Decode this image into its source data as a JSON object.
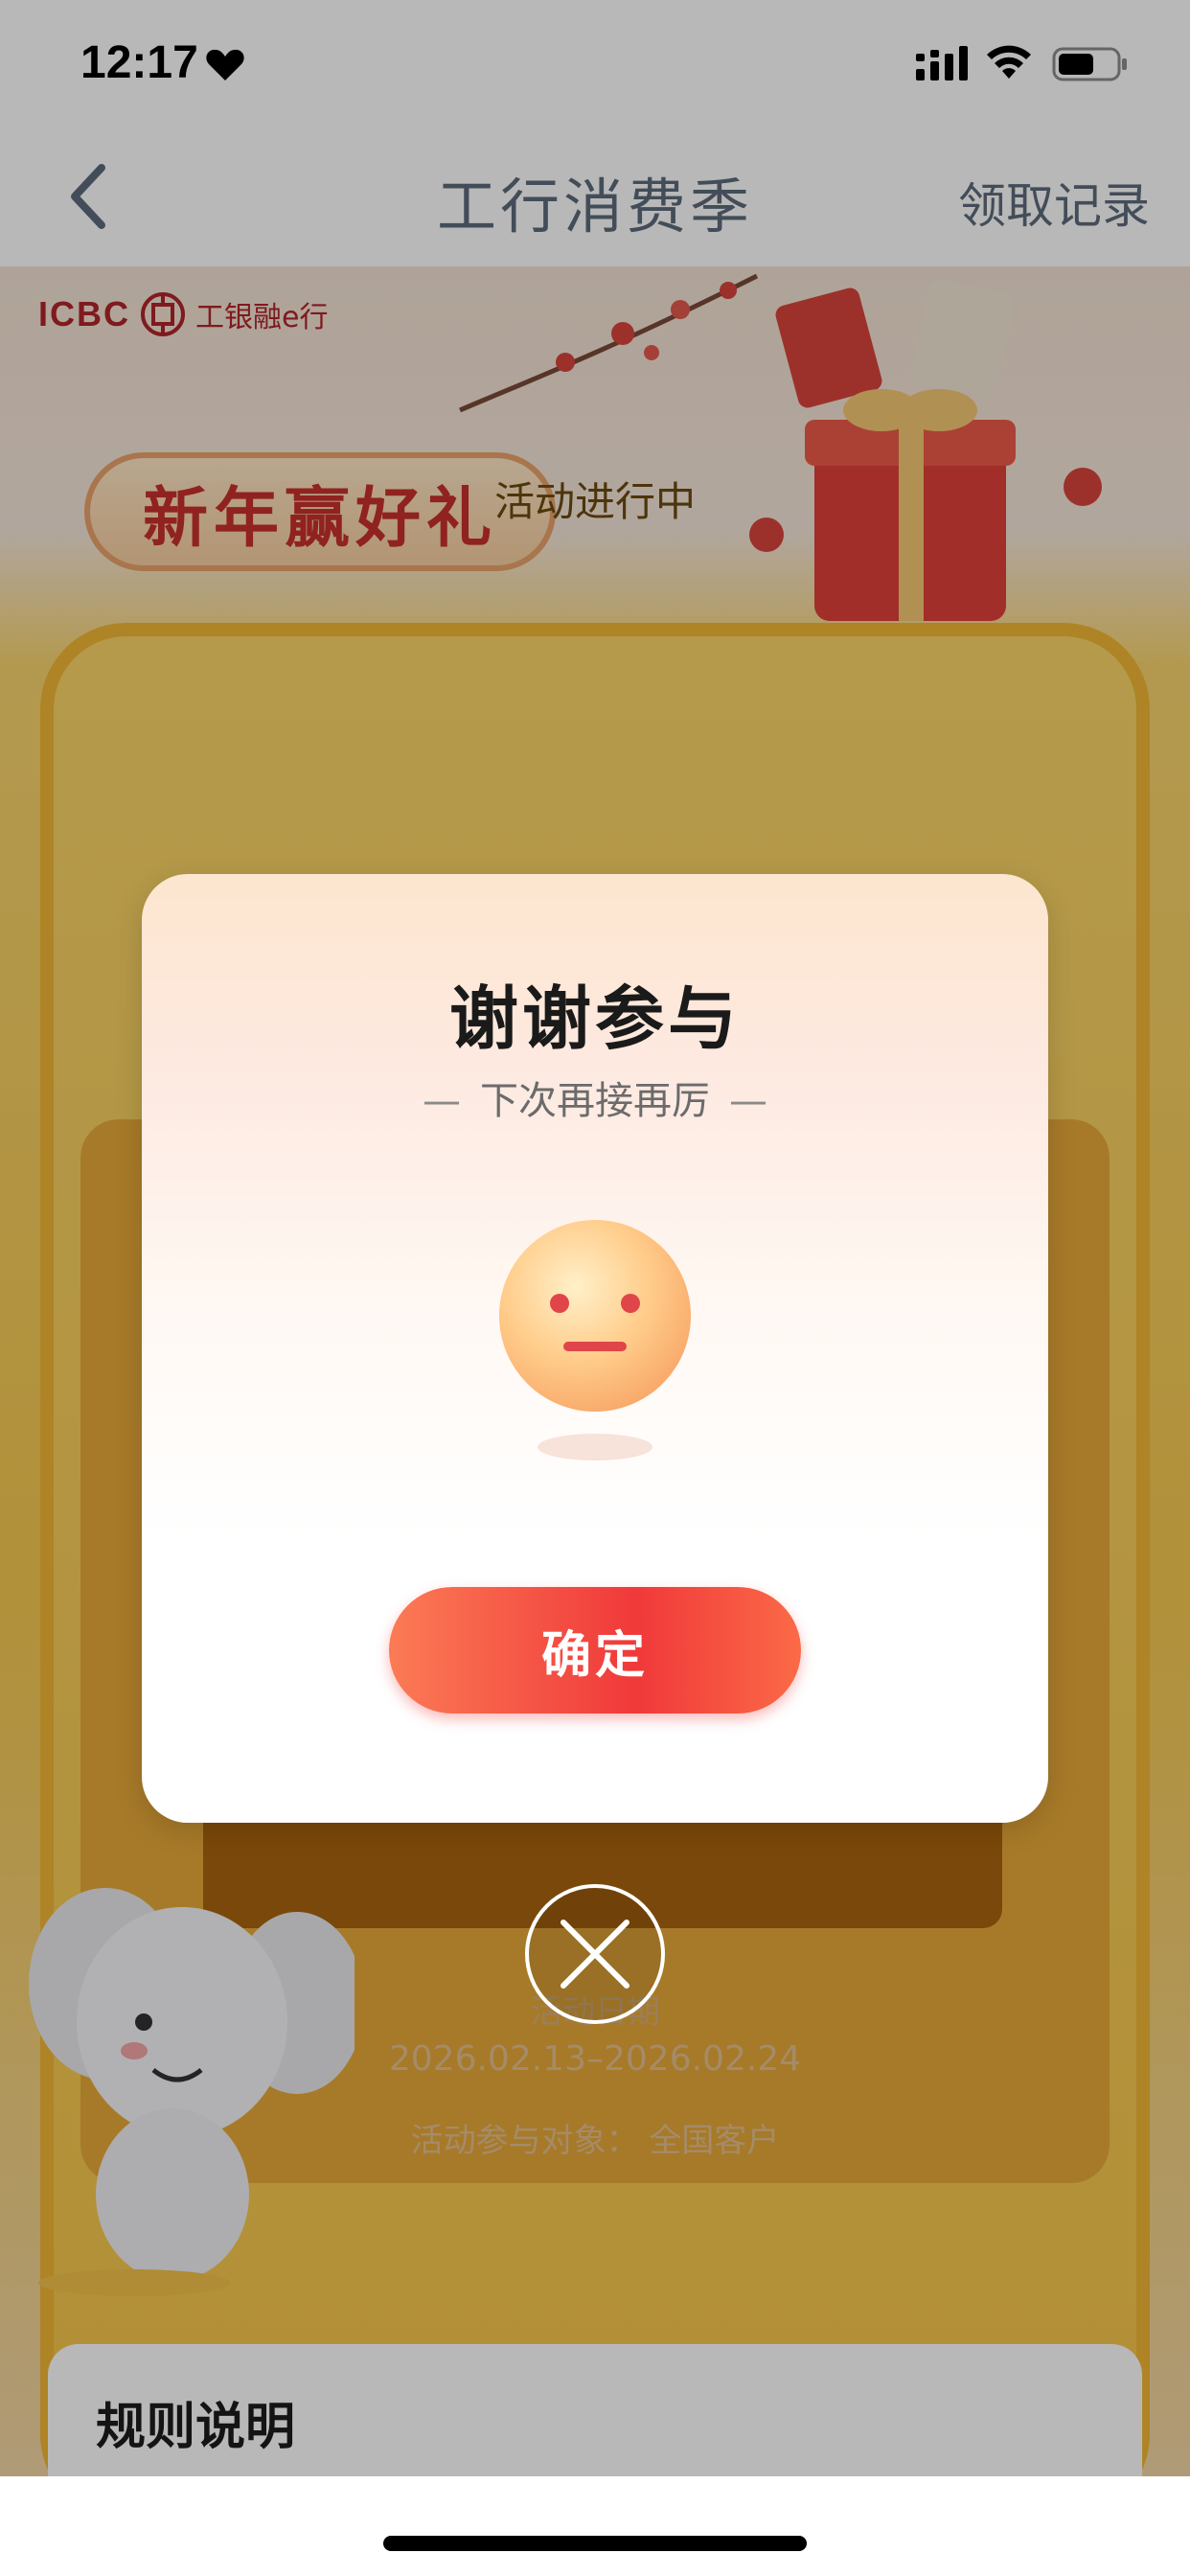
{
  "status_bar": {
    "time": "12:17"
  },
  "nav": {
    "title": "工行消费季",
    "right_link": "领取记录"
  },
  "page": {
    "brand": {
      "latin": "ICBC",
      "chinese": "工银融e行"
    },
    "hero_title": "新年赢好礼",
    "card_status": "活动进行中",
    "info": {
      "label": "活动日期",
      "date_range": "2026.02.13–2026.02.24",
      "target": "活动参与对象：  全国客户"
    },
    "rules_title": "规则说明"
  },
  "modal": {
    "title": "谢谢参与",
    "subtitle": "下次再接再厉",
    "confirm_label": "确定"
  },
  "colors": {
    "accent_red": "#f0393a",
    "nav_text": "#5d6b7c",
    "brand_red": "#b0252a"
  },
  "icons": {
    "back": "chevron-left-icon",
    "close": "close-icon",
    "face": "neutral-face-icon"
  }
}
